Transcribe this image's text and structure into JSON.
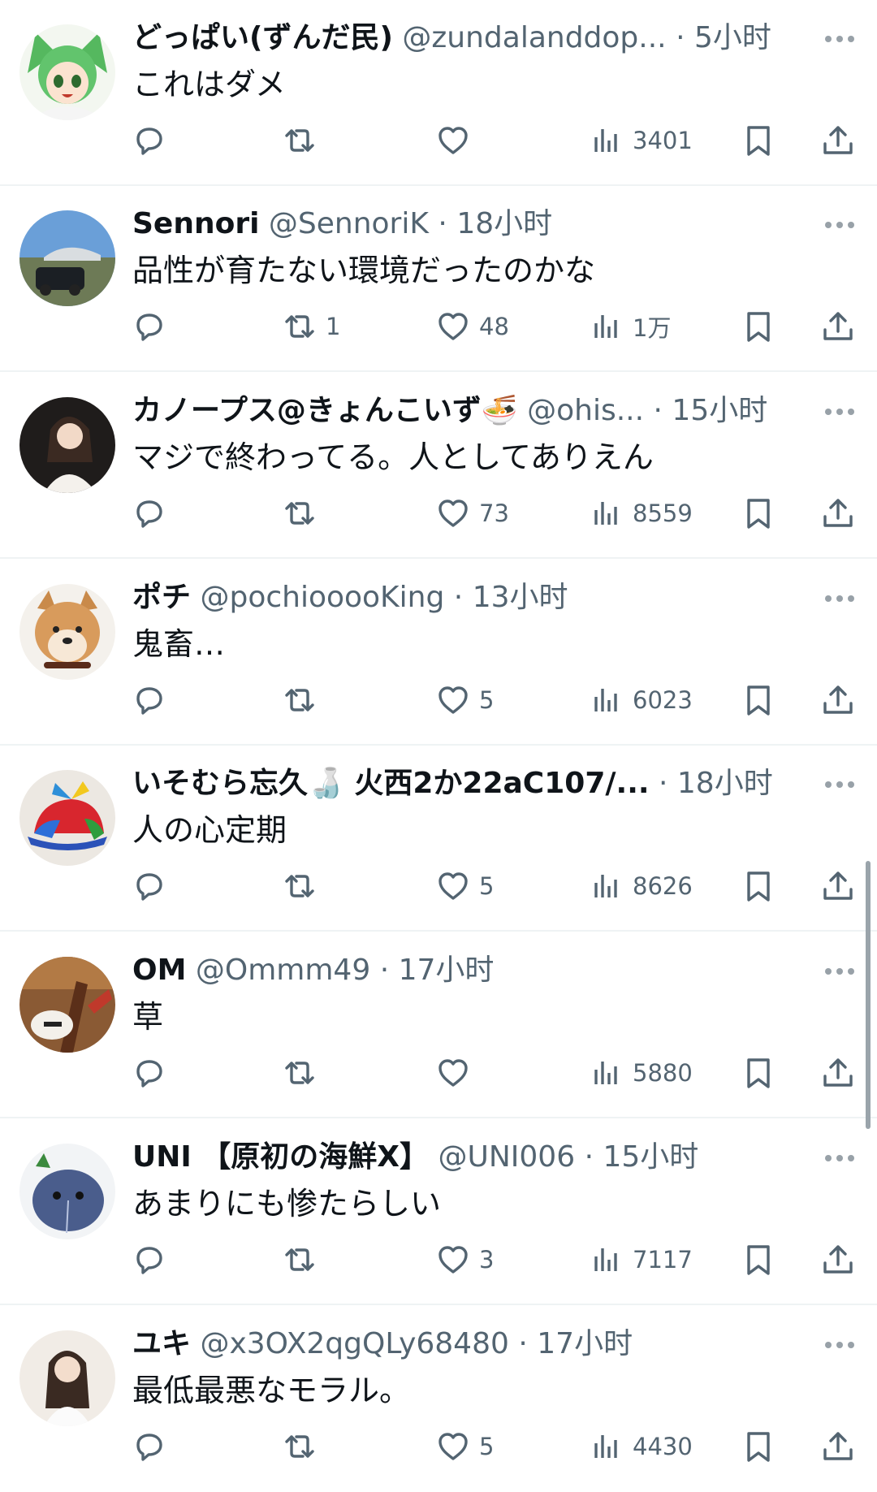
{
  "tweets": [
    {
      "display_name": "どっぱい(ずんだ民)",
      "handle": "@zundalanddop...",
      "time": "5小时",
      "text": "これはダメ",
      "replies": "",
      "retweets": "",
      "likes": "",
      "views": "3401",
      "avatar_color": "#4fae5c"
    },
    {
      "display_name": "Sennori",
      "handle": "@SennoriK",
      "time": "18小时",
      "text": "品性が育たない環境だったのかな",
      "replies": "",
      "retweets": "1",
      "likes": "48",
      "views": "1万",
      "avatar_color": "#5a8fd0"
    },
    {
      "display_name": "カノープス@きょんこいず🍜",
      "handle": "@ohis...",
      "time": "15小时",
      "text": "マジで終わってる。人としてありえん",
      "replies": "",
      "retweets": "",
      "likes": "73",
      "views": "8559",
      "avatar_color": "#2e2a28"
    },
    {
      "display_name": "ポチ",
      "handle": "@pochiooooKing",
      "time": "13小时",
      "text": "鬼畜…",
      "replies": "",
      "retweets": "",
      "likes": "5",
      "views": "6023",
      "avatar_color": "#d7a66a"
    },
    {
      "display_name": "いそむら忘久🍶 火西2か22aC107/...",
      "handle": "",
      "time": "18小时",
      "text": "人の心定期",
      "replies": "",
      "retweets": "",
      "likes": "5",
      "views": "8626",
      "avatar_color": "#e8e4dc"
    },
    {
      "display_name": "OM",
      "handle": "@Ommm49",
      "time": "17小时",
      "text": "草",
      "replies": "",
      "retweets": "",
      "likes": "",
      "views": "5880",
      "avatar_color": "#7a4a2a"
    },
    {
      "display_name": "UNI 【原初の海鮮X】",
      "handle": "@UNI006",
      "time": "15小时",
      "text": "あまりにも惨たらしい",
      "replies": "",
      "retweets": "",
      "likes": "3",
      "views": "7117",
      "avatar_color": "#4a5d8c"
    },
    {
      "display_name": "ユキ",
      "handle": "@x3OX2qgQLy68480",
      "time": "17小时",
      "text": "最低最悪なモラル。",
      "replies": "",
      "retweets": "",
      "likes": "5",
      "views": "4430",
      "avatar_color": "#efe4dc"
    }
  ],
  "icons": {
    "reply": "reply-icon",
    "retweet": "retweet-icon",
    "like": "like-icon",
    "views": "views-icon",
    "bookmark": "bookmark-icon",
    "share": "share-icon",
    "more": "more-icon"
  },
  "colors": {
    "text_primary": "#0f1419",
    "text_secondary": "#536471",
    "divider": "#eff3f4"
  }
}
